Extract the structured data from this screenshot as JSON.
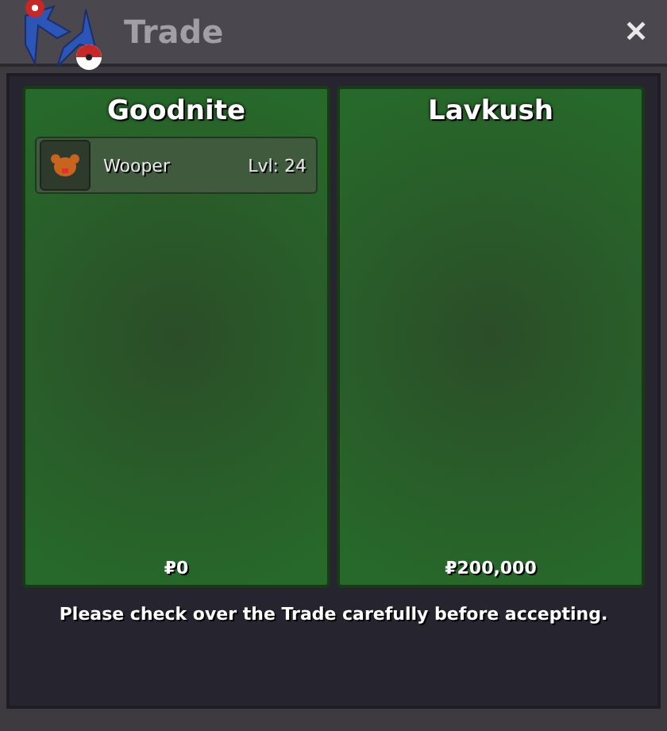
{
  "window": {
    "title": "Trade",
    "close": "✕"
  },
  "traders": [
    {
      "name": "Goodnite",
      "items": [
        {
          "name": "Wooper",
          "level": "Lvl: 24"
        }
      ],
      "money": "₽0"
    },
    {
      "name": "Lavkush",
      "money": "₽200,000"
    }
  ],
  "notice": "Please check over the Trade carefully before accepting."
}
